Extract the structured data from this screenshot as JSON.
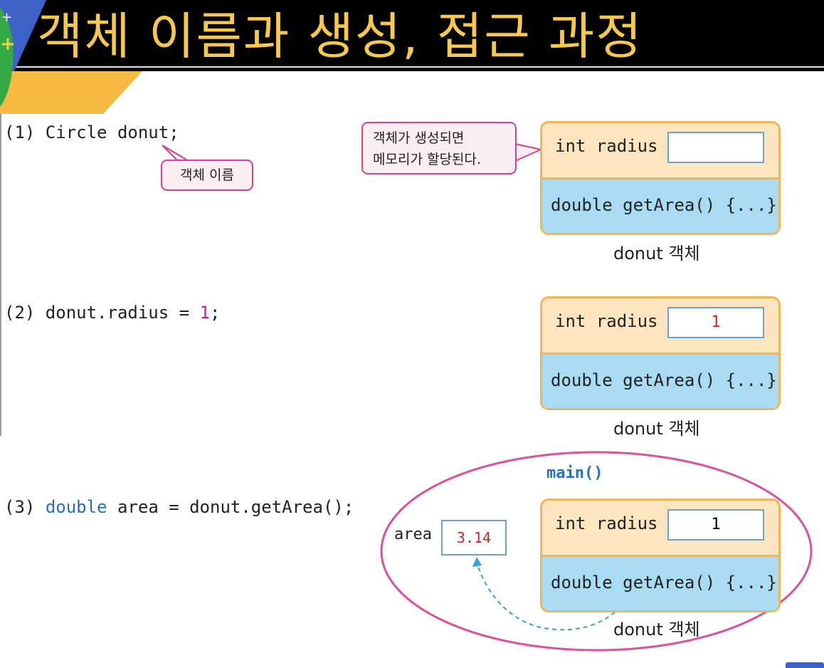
{
  "slide": {
    "title": "객체 이름과 생성, 접근 과정"
  },
  "steps": [
    {
      "num": "(1)",
      "code": " Circle donut;"
    },
    {
      "num": "(2)",
      "code": " donut.radius = ",
      "literal": "1",
      "tail": ";"
    },
    {
      "num": "(3)",
      "keyword": "double",
      "code": " area = donut.getArea();"
    }
  ],
  "callouts": {
    "object_name": "객체 이름",
    "memory_line1": "객체가 생성되면",
    "memory_line2": "메모리가 할당된다."
  },
  "objects": [
    {
      "field": "int radius",
      "value": "",
      "method": "double getArea() {...}",
      "label": "donut 객체"
    },
    {
      "field": "int radius",
      "value": "1",
      "method": "double getArea() {...}",
      "label": "donut 객체"
    },
    {
      "field": "int radius",
      "value": "1",
      "method": "double getArea() {...}",
      "label": "donut 객체"
    }
  ],
  "main_scope": {
    "label": "main()",
    "area_label": "area",
    "area_value": "3.14"
  },
  "colors": {
    "title": "#f6c94a",
    "keyword": "#2470c8",
    "literal": "#d4148a",
    "value_red": "#e02020",
    "object_border": "#f3b553",
    "field_bg": "#fde5c0",
    "method_bg": "#a9dcf2",
    "scope_ellipse": "#e0509a",
    "arrow": "#3aa0d8"
  }
}
